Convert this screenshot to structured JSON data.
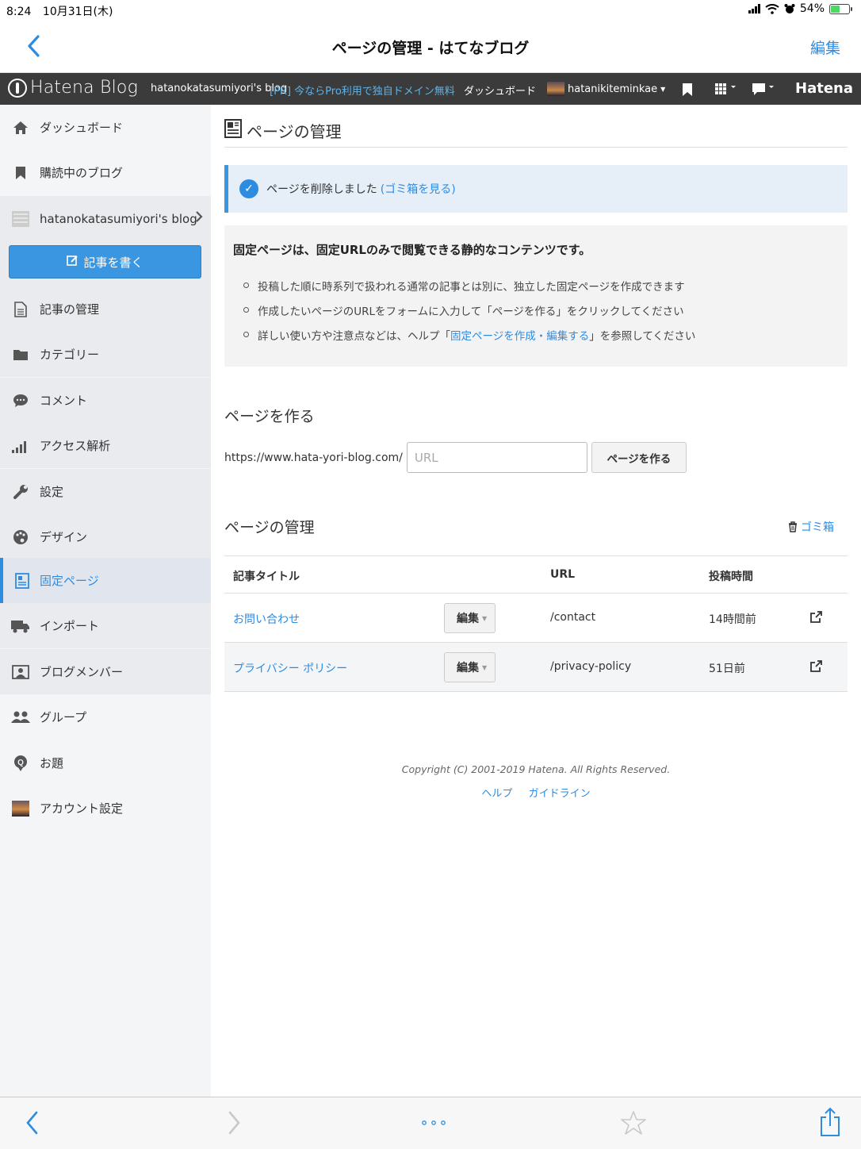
{
  "status": {
    "time": "8:24",
    "date": "10月31日(木)",
    "battery": "54%",
    "battery_level": 0.54
  },
  "nav": {
    "title": "ページの管理 - はてなブログ",
    "edit": "編集"
  },
  "header": {
    "logo": "Hatena Blog",
    "blog": "hatanokatasumiyori's blog",
    "promo": "[PR] 今ならPro利用で独自ドメイン無料",
    "dashboard": "ダッシュボード",
    "user": "hatanikiteminkae",
    "hatena": "Hatena"
  },
  "sidebar": {
    "items": [
      {
        "label": "ダッシュボード",
        "icon": "home-icon"
      },
      {
        "label": "購読中のブログ",
        "icon": "bookmark-icon"
      },
      {
        "label": "hatanokatasumiyori's blog",
        "icon": "blog-icon"
      },
      {
        "label": "記事の管理",
        "icon": "document-icon"
      },
      {
        "label": "カテゴリー",
        "icon": "folder-icon"
      },
      {
        "label": "コメント",
        "icon": "comment-icon"
      },
      {
        "label": "アクセス解析",
        "icon": "chart-icon"
      },
      {
        "label": "設定",
        "icon": "wrench-icon"
      },
      {
        "label": "デザイン",
        "icon": "palette-icon"
      },
      {
        "label": "固定ページ",
        "icon": "page-icon"
      },
      {
        "label": "インポート",
        "icon": "truck-icon"
      },
      {
        "label": "ブログメンバー",
        "icon": "member-icon"
      },
      {
        "label": "グループ",
        "icon": "group-icon"
      },
      {
        "label": "お題",
        "icon": "topic-icon"
      },
      {
        "label": "アカウント設定",
        "icon": "account-avatar-icon"
      }
    ],
    "write": "記事を書く"
  },
  "main": {
    "title": "ページの管理",
    "notice": {
      "text": "ページを削除しました",
      "link": "(ゴミ箱を見る)"
    },
    "info": {
      "lead": "固定ページは、固定URLのみで閲覧できる静的なコンテンツです。",
      "b1": "投稿した順に時系列で扱われる通常の記事とは別に、独立した固定ページを作成できます",
      "b2": "作成したいページのURLをフォームに入力して「ページを作る」をクリックしてください",
      "b3_pre": "詳しい使い方や注意点などは、ヘルプ「",
      "b3_link": "固定ページを作成・編集する",
      "b3_post": "」を参照してください"
    },
    "create": {
      "heading": "ページを作る",
      "base_url": "https://www.hata-yori-blog.com/",
      "placeholder": "URL",
      "button": "ページを作る"
    },
    "manage": {
      "heading": "ページの管理",
      "trash": "ゴミ箱"
    },
    "table": {
      "headers": [
        "記事タイトル",
        "URL",
        "投稿時間"
      ],
      "rows": [
        {
          "title": "お問い合わせ",
          "edit": "編集",
          "url": "/contact",
          "time": "14時間前"
        },
        {
          "title": "プライバシー ポリシー",
          "edit": "編集",
          "url": "/privacy-policy",
          "time": "51日前"
        }
      ]
    },
    "footer": {
      "copyright": "Copyright (C) 2001-2019 Hatena. All Rights Reserved.",
      "help": "ヘルプ",
      "guide": "ガイドライン"
    }
  },
  "colors": {
    "accent": "#2e8ce0",
    "header_bg": "#3b3b3b",
    "sidebar_bg": "#f4f5f7"
  }
}
